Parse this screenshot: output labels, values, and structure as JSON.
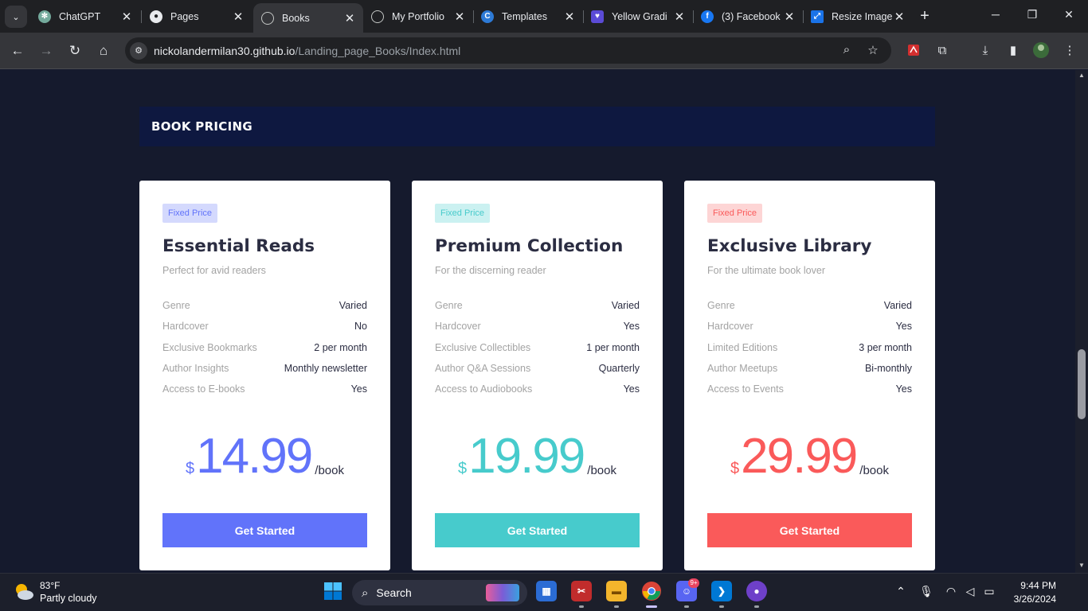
{
  "browser": {
    "tabs": [
      {
        "title": "ChatGPT",
        "icon": "chatgpt-icon"
      },
      {
        "title": "Pages",
        "icon": "github-icon"
      },
      {
        "title": "Books",
        "icon": "globe-icon",
        "active": true
      },
      {
        "title": "My Portfolio",
        "icon": "globe-icon"
      },
      {
        "title": "Templates",
        "icon": "canva-icon"
      },
      {
        "title": "Yellow Gradi",
        "icon": "heart-icon"
      },
      {
        "title": "(3) Facebook",
        "icon": "facebook-icon"
      },
      {
        "title": "Resize Image",
        "icon": "resize-icon"
      }
    ],
    "close_glyph": "✕",
    "url_host": "nickolandermilan30.github.io",
    "url_path": "/Landing_page_Books/Index.html"
  },
  "page": {
    "section_title": "BOOK PRICING",
    "cards": [
      {
        "badge": "Fixed Price",
        "title": "Essential Reads",
        "subtitle": "Perfect for avid readers",
        "accent": "#6173fa",
        "badge_bg": "#d4d9fd",
        "features": [
          {
            "name": "Genre",
            "value": "Varied"
          },
          {
            "name": "Hardcover",
            "value": "No"
          },
          {
            "name": "Exclusive Bookmarks",
            "value": "2 per month"
          },
          {
            "name": "Author Insights",
            "value": "Monthly newsletter"
          },
          {
            "name": "Access to E-books",
            "value": "Yes"
          }
        ],
        "currency": "$",
        "price": "14.99",
        "unit": "/book",
        "cta": "Get Started"
      },
      {
        "badge": "Fixed Price",
        "title": "Premium Collection",
        "subtitle": "For the discerning reader",
        "accent": "#47cbcc",
        "badge_bg": "#cbf1f1",
        "features": [
          {
            "name": "Genre",
            "value": "Varied"
          },
          {
            "name": "Hardcover",
            "value": "Yes"
          },
          {
            "name": "Exclusive Collectibles",
            "value": "1 per month"
          },
          {
            "name": "Author Q&A Sessions",
            "value": "Quarterly"
          },
          {
            "name": "Access to Audiobooks",
            "value": "Yes"
          }
        ],
        "currency": "$",
        "price": "19.99",
        "unit": "/book",
        "cta": "Get Started"
      },
      {
        "badge": "Fixed Price",
        "title": "Exclusive Library",
        "subtitle": "For the ultimate book lover",
        "accent": "#fa5a5a",
        "badge_bg": "#fdd5d5",
        "features": [
          {
            "name": "Genre",
            "value": "Varied"
          },
          {
            "name": "Hardcover",
            "value": "Yes"
          },
          {
            "name": "Limited Editions",
            "value": "3 per month"
          },
          {
            "name": "Author Meetups",
            "value": "Bi-monthly"
          },
          {
            "name": "Access to Events",
            "value": "Yes"
          }
        ],
        "currency": "$",
        "price": "29.99",
        "unit": "/book",
        "cta": "Get Started"
      }
    ]
  },
  "taskbar": {
    "weather_temp": "83°F",
    "weather_desc": "Partly cloudy",
    "search_label": "Search",
    "discord_badge": "9+",
    "time": "9:44 PM",
    "date": "3/26/2024"
  }
}
